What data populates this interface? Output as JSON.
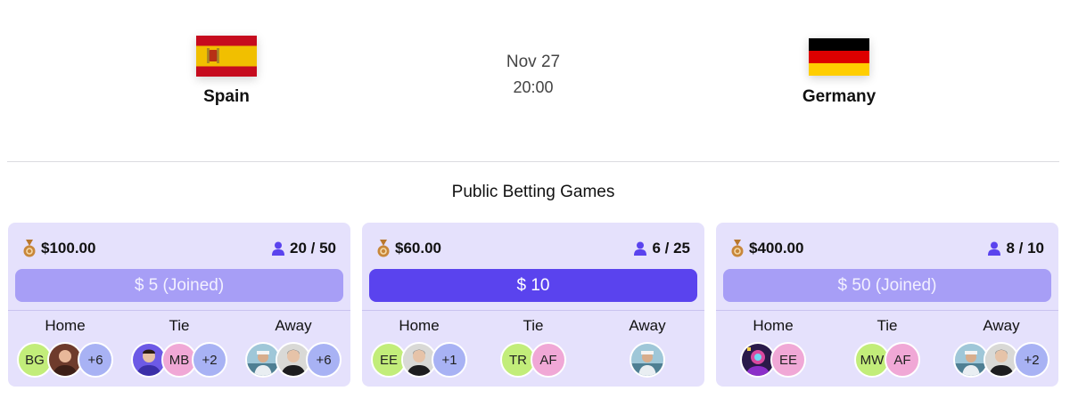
{
  "match": {
    "home_team": "Spain",
    "away_team": "Germany",
    "date": "Nov 27",
    "time": "20:00"
  },
  "section_title": "Public Betting Games",
  "colors": {
    "card_bg": "#e5e1fc",
    "accent": "#5a43ee",
    "joined": "#a79ef6",
    "avatar_green": "#c2ed7a",
    "avatar_pink": "#f0a8d6",
    "avatar_blue": "#a8b2f4"
  },
  "games": [
    {
      "prize": "$100.00",
      "players": "20 / 50",
      "button_label": "$ 5 (Joined)",
      "joined": true,
      "outcomes": [
        {
          "label": "Home",
          "avatars": [
            "BG",
            "photo",
            "+6"
          ]
        },
        {
          "label": "Tie",
          "avatars": [
            "photo",
            "MB",
            "+2"
          ]
        },
        {
          "label": "Away",
          "avatars": [
            "photo",
            "photo",
            "+6"
          ]
        }
      ]
    },
    {
      "prize": "$60.00",
      "players": "6 / 25",
      "button_label": "$ 10",
      "joined": false,
      "outcomes": [
        {
          "label": "Home",
          "avatars": [
            "EE",
            "photo",
            "+1"
          ]
        },
        {
          "label": "Tie",
          "avatars": [
            "TR",
            "AF"
          ]
        },
        {
          "label": "Away",
          "avatars": [
            "photo"
          ]
        }
      ]
    },
    {
      "prize": "$400.00",
      "players": "8 / 10",
      "button_label": "$ 50 (Joined)",
      "joined": true,
      "outcomes": [
        {
          "label": "Home",
          "avatars": [
            "photo",
            "EE"
          ]
        },
        {
          "label": "Tie",
          "avatars": [
            "MW",
            "AF"
          ]
        },
        {
          "label": "Away",
          "avatars": [
            "photo",
            "photo",
            "+2"
          ]
        }
      ]
    }
  ]
}
